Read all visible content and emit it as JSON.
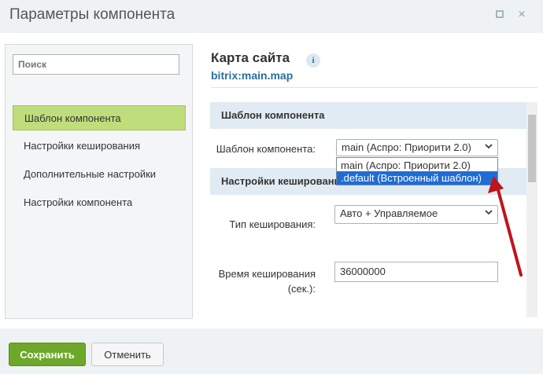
{
  "window": {
    "title": "Параметры компонента",
    "maximize_icon": "square-icon",
    "close_icon": "×"
  },
  "sidebar": {
    "search_placeholder": "Поиск",
    "items": [
      {
        "label": "Шаблон компонента",
        "active": true
      },
      {
        "label": "Настройки кеширования",
        "active": false
      },
      {
        "label": "Дополнительные настройки",
        "active": false
      },
      {
        "label": "Настройки компонента",
        "active": false
      }
    ]
  },
  "component": {
    "title": "Карта сайта",
    "code": "bitrix:main.map",
    "info_icon": "i"
  },
  "sections": {
    "template": {
      "heading": "Шаблон компонента",
      "field_label": "Шаблон компонента:",
      "selected": "main (Аспро: Приорити 2.0)",
      "options": [
        "main (Аспро: Приорити 2.0)",
        ".default (Встроенный шаблон)"
      ],
      "highlighted_option": ".default (Встроенный шаблон)"
    },
    "cache": {
      "heading": "Настройки кеширования",
      "type_label": "Тип кеширования:",
      "type_value": "Авто + Управляемое",
      "time_label_1": "Время кеширования",
      "time_label_2": "(сек.):",
      "time_value": "36000000"
    }
  },
  "footer": {
    "save_label": "Сохранить",
    "cancel_label": "Отменить"
  },
  "colors": {
    "accent_green": "#6ea82a",
    "active_nav": "#bfdd7a",
    "link_blue": "#2b6f9e",
    "highlight_blue": "#1e6cd4",
    "arrow_red": "#c0141c"
  }
}
